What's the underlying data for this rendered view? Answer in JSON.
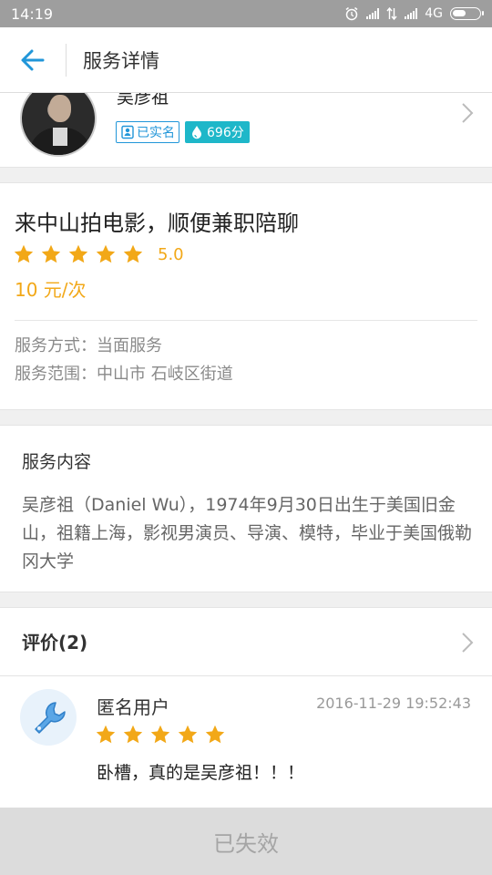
{
  "status_bar": {
    "time": "14:19",
    "network": "4G",
    "icons": [
      "alarm-icon",
      "signal-icon",
      "data-arrows-icon",
      "signal-icon",
      "battery-icon"
    ]
  },
  "header": {
    "title": "服务详情",
    "back_icon": "arrow-left-icon",
    "accent_color": "#2196d9"
  },
  "provider": {
    "name": "吴彦祖",
    "verified_label": "已实名",
    "score_label": "696分"
  },
  "service": {
    "title": "来中山拍电影，顺便兼职陪聊",
    "rating": "5.0",
    "stars": 5,
    "price": "10 元/次",
    "method": "服务方式：当面服务",
    "area": "服务范围：中山市 石岐区街道",
    "star_color": "#f2a818"
  },
  "description": {
    "title": "服务内容",
    "body": "吴彦祖（Daniel Wu），1974年9月30日出生于美国旧金山，祖籍上海，影视男演员、导演、模特，毕业于美国俄勒冈大学"
  },
  "reviews": {
    "header": "评价(2)",
    "items": [
      {
        "user": "匿名用户",
        "time": "2016-11-29 19:52:43",
        "stars": 5,
        "text": "卧槽，真的是吴彦祖！！！"
      }
    ]
  },
  "bottom_bar": {
    "label": "已失效"
  }
}
